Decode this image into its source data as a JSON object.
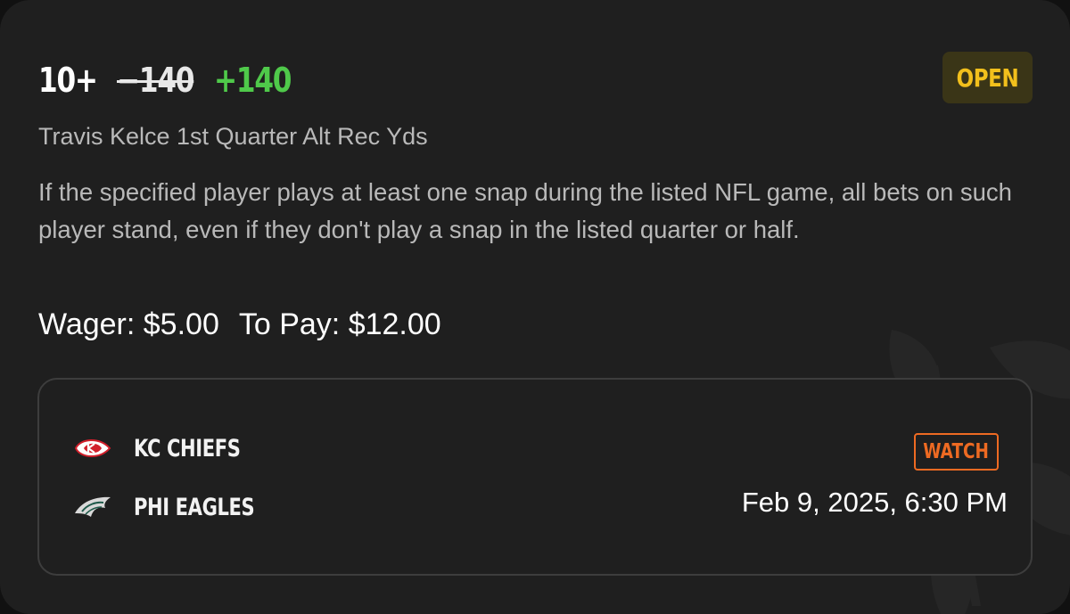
{
  "bet": {
    "leg": "10+",
    "old_odds": "−140",
    "new_odds": "+140",
    "status": "OPEN",
    "market": "Travis Kelce 1st Quarter Alt Rec Yds",
    "rules": "If the specified player plays at least one snap during the listed NFL game, all bets on such player stand, even if they don't play a snap in the listed quarter or half.",
    "wager_text": "Wager: $5.00",
    "to_pay_text": "To Pay: $12.00"
  },
  "game": {
    "home_team": "KC CHIEFS",
    "home_logo": "chiefs-logo-icon",
    "away_team": "PHI EAGLES",
    "away_logo": "eagles-logo-icon",
    "watch_label": "WATCH",
    "datetime": "Feb 9, 2025, 6:30 PM"
  },
  "colors": {
    "card_bg": "#1f1f1f",
    "odds_green": "#4fc94a",
    "open_badge_text": "#f2c01c",
    "open_badge_bg": "#3a3517",
    "watch_orange": "#ee6a22"
  }
}
